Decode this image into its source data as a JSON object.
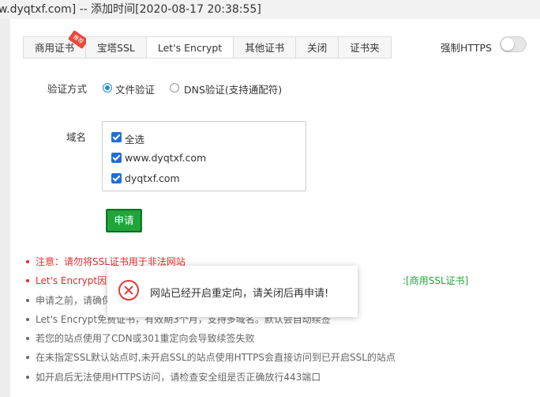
{
  "window": {
    "title": "w.dyqtxf.com] -- 添加时间[2020-08-17 20:38:55]"
  },
  "tabs": [
    {
      "label": "商用证书",
      "badge": "推荐"
    },
    {
      "label": "宝塔SSL"
    },
    {
      "label": "Let's Encrypt",
      "active": true
    },
    {
      "label": "其他证书"
    },
    {
      "label": "关闭"
    },
    {
      "label": "证书夹"
    }
  ],
  "force_https": {
    "label": "强制HTTPS",
    "enabled": false
  },
  "verify": {
    "label": "验证方式",
    "options": [
      {
        "label": "文件验证",
        "selected": true
      },
      {
        "label": "DNS验证(支持通配符)",
        "selected": false
      }
    ]
  },
  "domains": {
    "label": "域名",
    "items": [
      {
        "label": "全选",
        "checked": true
      },
      {
        "label": "www.dyqtxf.com",
        "checked": true
      },
      {
        "label": "dyqtxf.com",
        "checked": true
      }
    ]
  },
  "apply_button": "申请",
  "notes": [
    {
      "text": "注意：请勿将SSL证书用于非法网站",
      "style": "red"
    },
    {
      "text": "Let's Encrypt因更",
      "tail": ":[商用SSL证书]",
      "style": "red"
    },
    {
      "text": "申请之前，请确保"
    },
    {
      "text": "Let's Encrypt免费证书，有效期3个月，支持多域名。默认会自动续签"
    },
    {
      "text": "若您的站点使用了CDN或301重定向会导致续签失败"
    },
    {
      "text": "在未指定SSL默认站点时,未开启SSL的站点使用HTTPS会直接访问到已开启SSL的站点"
    },
    {
      "text": "如开启后无法使用HTTPS访问，请检查安全组是否正确放行443端口"
    }
  ],
  "toast": {
    "message": "网站已经开启重定向，请关闭后再申请!",
    "icon": "error-icon"
  },
  "colors": {
    "accent": "#20a53a",
    "error": "#e53935",
    "link_blue": "#1e6fd9"
  }
}
